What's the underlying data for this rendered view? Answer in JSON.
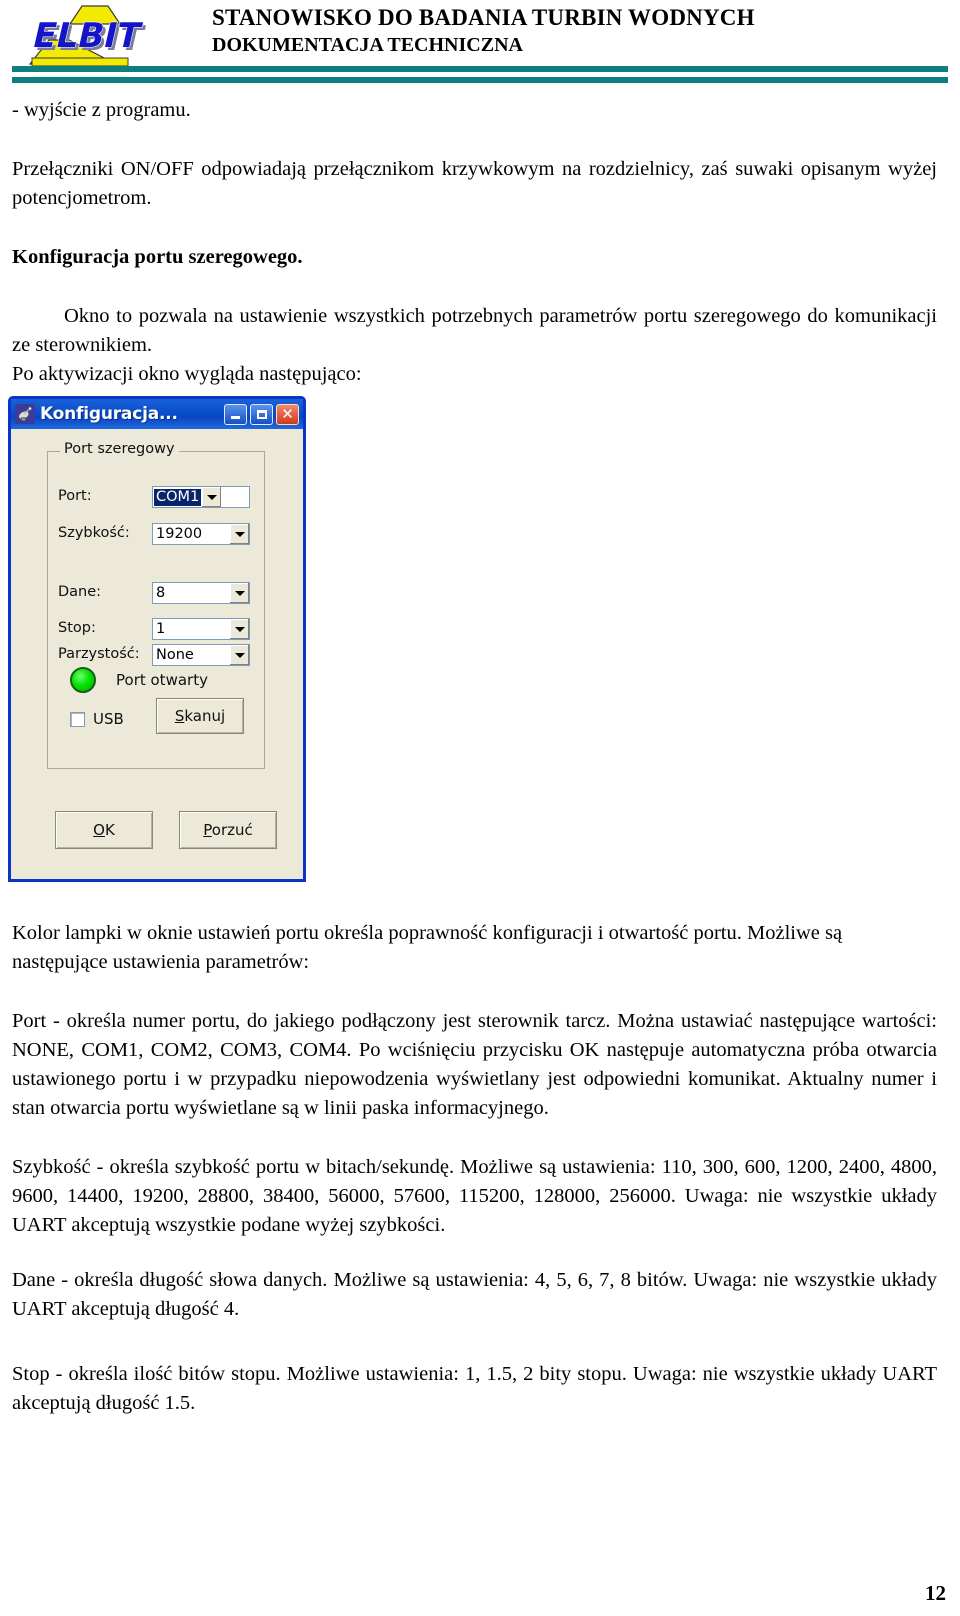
{
  "header": {
    "logo_text": "ELBIT",
    "title_line1": "STANOWISKO DO BADANIA TURBIN WODNYCH",
    "title_line2": "DOKUMENTACJA TECHNICZNA"
  },
  "body": {
    "line_exit": "- wyjście z programu.",
    "para_switches": "Przełączniki ON/OFF odpowiadają przełącznikom krzywkowym na rozdzielnicy, zaś suwaki opisanym wyżej potencjometrom.",
    "heading_config": "Konfiguracja portu szeregowego.",
    "para_window": "Okno to pozwala na ustawienie wszystkich potrzebnych parametrów portu szeregowego do komunikacji ze sterownikiem.",
    "para_after_activation": "Po aktywizacji okno wygląda następująco:",
    "para_lamp": "Kolor lampki w oknie ustawień portu określa poprawność konfiguracji i otwartość portu. Możliwe są następujące ustawienia parametrów:",
    "para_port": "Port - określa numer portu, do jakiego podłączony jest sterownik tarcz. Można ustawiać następujące wartości: NONE, COM1, COM2, COM3, COM4. Po wciśnięciu przycisku OK następuje automatyczna próba otwarcia ustawionego portu i w przypadku niepowodzenia wyświetlany jest odpowiedni komunikat. Aktualny numer i stan otwarcia portu wyświetlane są w linii paska informacyjnego.",
    "para_speed": "Szybkość - określa szybkość portu w bitach/sekundę. Możliwe są ustawienia: 110, 300, 600, 1200, 2400, 4800, 9600, 14400, 19200, 28800, 38400, 56000, 57600, 115200, 128000, 256000. Uwaga: nie wszystkie układy UART akceptują wszystkie podane wyżej szybkości.",
    "para_data": "Dane - określa długość słowa danych. Możliwe są ustawienia: 4, 5, 6, 7, 8 bitów. Uwaga: nie wszystkie układy UART akceptują długość 4.",
    "para_stop": "Stop - określa ilość bitów stopu. Możliwe ustawienia: 1, 1.5, 2 bity stopu. Uwaga: nie wszystkie układy UART akceptują długość 1.5."
  },
  "dialog": {
    "title": "Konfiguracja...",
    "icon_name": "satellite-dish-icon",
    "titlebar_color": "#0a4ecc",
    "minimize_label": "",
    "maximize_label": "",
    "close_label": "✕",
    "groupbox_label": "Port szeregowy",
    "fields": [
      {
        "label": "Port:",
        "value": "COM1",
        "selected": true
      },
      {
        "label": "Szybkość:",
        "value": "19200",
        "selected": false
      },
      {
        "label": "Dane:",
        "value": "8",
        "selected": false
      },
      {
        "label": "Stop:",
        "value": "1",
        "selected": false
      },
      {
        "label": "Parzystość:",
        "value": "None",
        "selected": false
      }
    ],
    "status": {
      "lamp_color": "#00e000",
      "lamp_text": "Port otwarty"
    },
    "usb_label": "USB",
    "usb_checked": false,
    "scan_button": {
      "accel": "S",
      "rest": "kanuj"
    },
    "ok_button": {
      "accel": "O",
      "rest": "K"
    },
    "cancel_button": {
      "accel": "P",
      "rest": "orzuć"
    }
  },
  "footer": {
    "page_number": "12"
  }
}
